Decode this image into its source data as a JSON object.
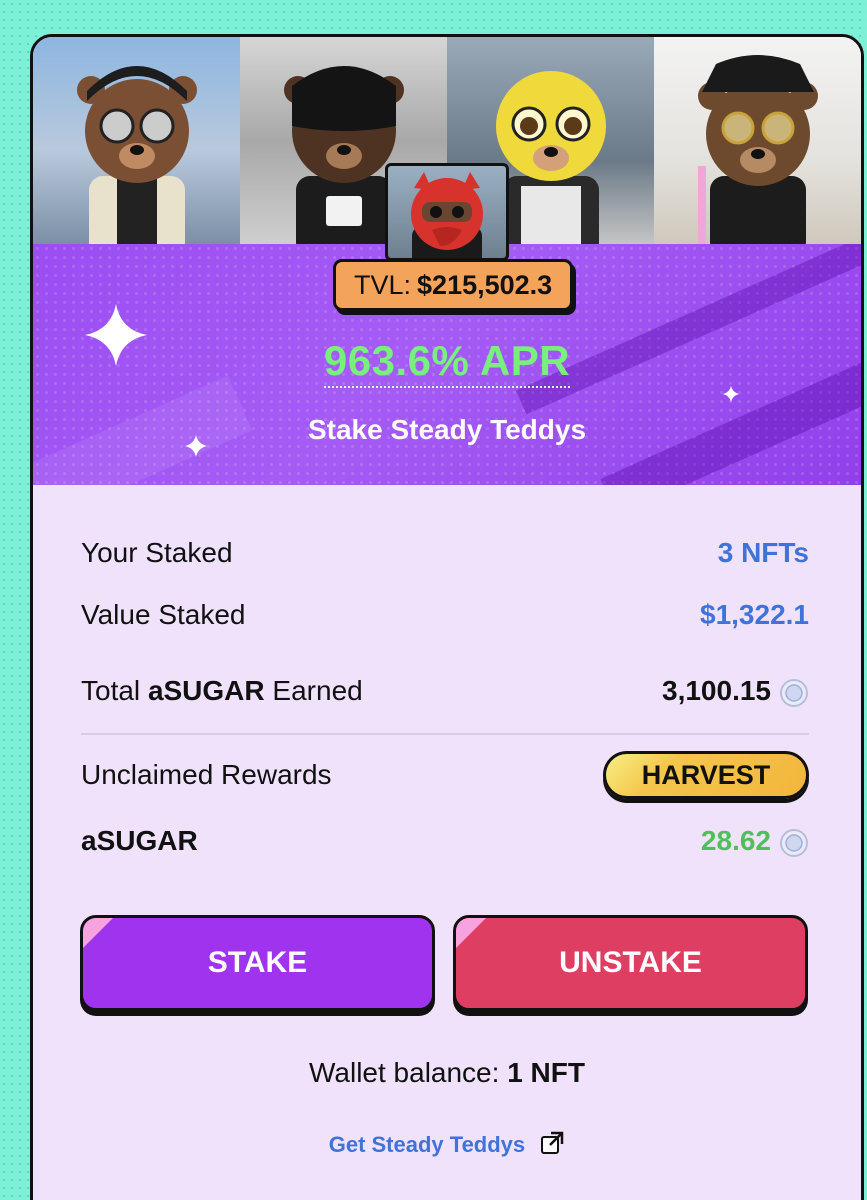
{
  "banner": {
    "tvl_label": "TVL:",
    "tvl_value": "$215,502.3",
    "apr": "963.6% APR",
    "title": "Stake Steady Teddys"
  },
  "stats": {
    "your_staked_label": "Your Staked",
    "your_staked_value": "3 NFTs",
    "value_staked_label": "Value Staked",
    "value_staked_value": "$1,322.1",
    "total_earned_prefix": "Total",
    "total_earned_token": "aSUGAR",
    "total_earned_suffix": "Earned",
    "total_earned_value": "3,100.15",
    "unclaimed_label": "Unclaimed Rewards",
    "harvest_label": "HARVEST",
    "reward_token": "aSUGAR",
    "reward_value": "28.62"
  },
  "actions": {
    "stake_label": "STAKE",
    "unstake_label": "UNSTAKE"
  },
  "wallet": {
    "label": "Wallet balance:",
    "value": "1 NFT"
  },
  "link": {
    "label": "Get Steady Teddys"
  },
  "icons": {
    "coin": "asugar-coin-icon",
    "external": "external-link-icon",
    "sparkle": "sparkle-icon"
  },
  "colors": {
    "accent_purple": "#a033ee",
    "unstake_red": "#df3e63",
    "link_blue": "#3f73d9",
    "apr_green": "#79f07e",
    "tvl_orange": "#f3a35a",
    "harvest_yellow": "#f5c64c"
  }
}
